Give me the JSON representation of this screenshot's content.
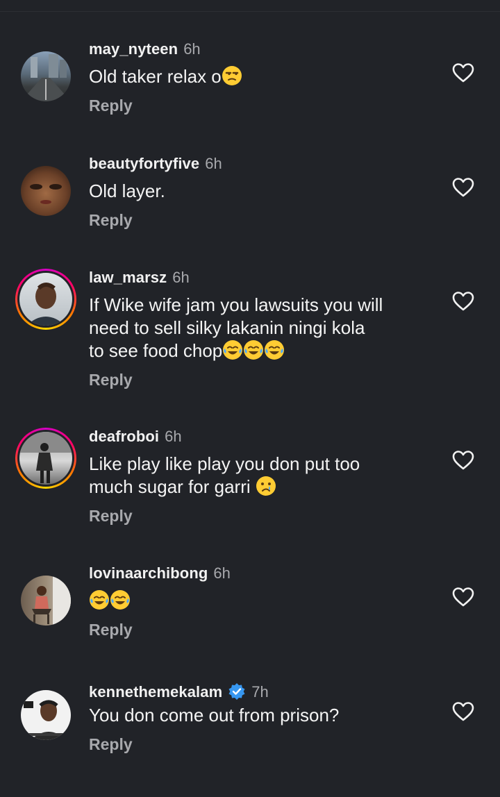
{
  "reply_label": "Reply",
  "colors": {
    "background": "#212328",
    "muted": "#a8a9ad",
    "verified": "#3797f0"
  },
  "comments": [
    {
      "username": "may_nyteen",
      "time": "6h",
      "text": "Old taker relax o",
      "emojis": [
        "unamused-face"
      ],
      "has_story_ring": false,
      "verified": false
    },
    {
      "username": "beautyfortyfive",
      "time": "6h",
      "text": "Old layer.",
      "emojis": [],
      "has_story_ring": false,
      "verified": false
    },
    {
      "username": "law_marsz",
      "time": "6h",
      "text_lines": [
        "If Wike wife jam you lawsuits you will",
        "need to sell silky lakanin ningi kola",
        "to see food chop"
      ],
      "emojis": [
        "tears-of-joy",
        "tears-of-joy",
        "tears-of-joy"
      ],
      "has_story_ring": true,
      "verified": false
    },
    {
      "username": "deafroboi",
      "time": "6h",
      "text_lines": [
        "Like play like play you don put too",
        "much sugar for garri "
      ],
      "emojis": [
        "sad-crying-face"
      ],
      "has_story_ring": true,
      "verified": false
    },
    {
      "username": "lovinaarchibong",
      "time": "6h",
      "text": "",
      "emojis": [
        "tears-of-joy",
        "tears-of-joy"
      ],
      "has_story_ring": false,
      "verified": false
    },
    {
      "username": "kennethemekalam",
      "time": "7h",
      "text": "You don come out from prison?",
      "emojis": [],
      "has_story_ring": false,
      "verified": true
    }
  ]
}
